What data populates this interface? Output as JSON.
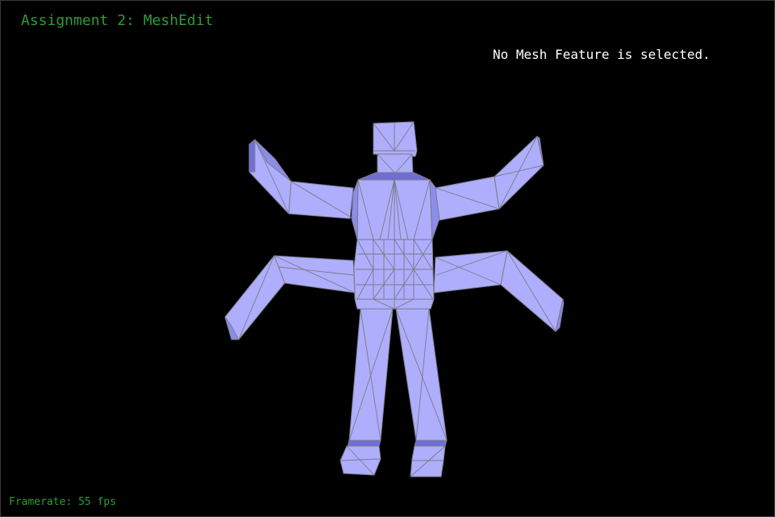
{
  "app": {
    "title": "Assignment 2: MeshEdit"
  },
  "status": {
    "selection_message": "No Mesh Feature is selected.",
    "framerate_text": "Framerate: 55 fps"
  },
  "viewport": {
    "background": "#000000",
    "mesh_color": "#aeaefc",
    "mesh_shadow_color": "#6e6ed6",
    "edge_color": "#7a7a8a",
    "hud_text_color": "#2e9b3a",
    "status_text_color": "#ffffff"
  }
}
